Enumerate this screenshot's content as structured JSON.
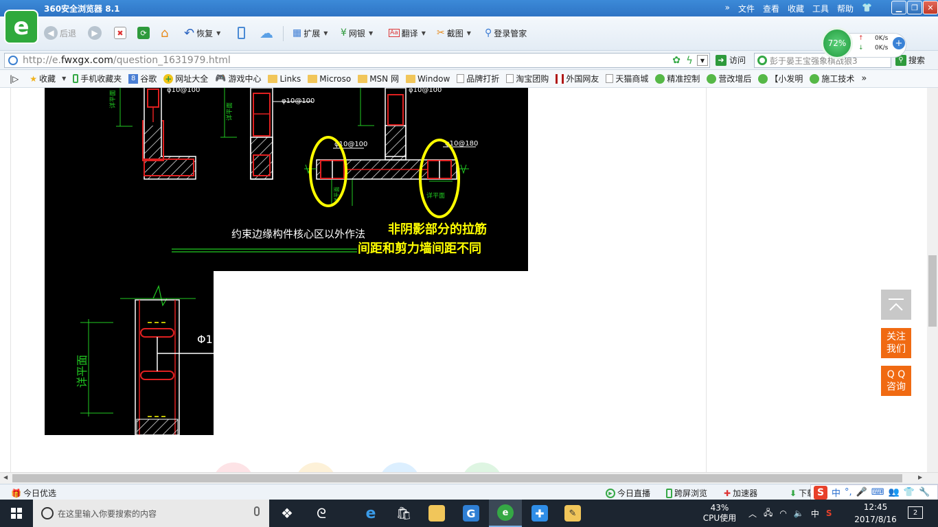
{
  "titlebar": {
    "title": "360安全浏览器 8.1",
    "menu": [
      "文件",
      "查看",
      "收藏",
      "工具",
      "帮助"
    ]
  },
  "toolbar": {
    "back": "后退",
    "restore": "恢复",
    "extend": "扩展",
    "bank": "网银",
    "translate": "翻译",
    "screenshot": "截图",
    "login": "登录管家"
  },
  "speed": {
    "percent": "72%",
    "up": "0K/s",
    "down": "0K/s"
  },
  "address": {
    "url_prefix": "http://e.",
    "url_domain": "fwxgx.com",
    "url_path": "/question_1631979.html",
    "visit": "访问",
    "search_text": "彭于晏王宝强象棋战狼3",
    "search_button": "搜索"
  },
  "bookmarks": [
    {
      "label": "收藏",
      "icon": "star"
    },
    {
      "label": "手机收藏夹",
      "icon": "phone"
    },
    {
      "label": "谷歌",
      "icon": "g"
    },
    {
      "label": "网址大全",
      "icon": "plus"
    },
    {
      "label": "游戏中心",
      "icon": "gamepad"
    },
    {
      "label": "Links",
      "icon": "folder"
    },
    {
      "label": "Microso",
      "icon": "folder"
    },
    {
      "label": "MSN 网",
      "icon": "folder"
    },
    {
      "label": "Window",
      "icon": "folder"
    },
    {
      "label": "品牌打折",
      "icon": "page"
    },
    {
      "label": "淘宝团购",
      "icon": "page"
    },
    {
      "label": "外国网友",
      "icon": "flag"
    },
    {
      "label": "天猫商城",
      "icon": "page"
    },
    {
      "label": "精准控制",
      "icon": "chat"
    },
    {
      "label": "营改增后",
      "icon": "chat"
    },
    {
      "label": "【小发明",
      "icon": "chat"
    },
    {
      "label": "施工技术",
      "icon": "chat"
    }
  ],
  "cad": {
    "rebar_labels": [
      "φ10@100",
      "φ10@100",
      "φ10@100",
      "φ10@100",
      "φ10@100",
      "φ10@180"
    ],
    "dim_label": "详平面",
    "title_line": "约束边缘构件核心区以外作法",
    "annotation_line1": "非阴影部分的拉筋",
    "annotation_line2": "间距和剪力墙间距不同",
    "cut_label": "Φ1"
  },
  "float": {
    "follow": "关注\n我们",
    "qq": "Q Q\n咨询"
  },
  "statusbar": {
    "today_pick": "今日优选",
    "live": "今日直播",
    "cross_screen": "跨屏浏览",
    "accelerator": "加速器",
    "download": "下载"
  },
  "taskbar": {
    "search_placeholder": "在这里输入你要搜索的内容",
    "cpu_percent": "43%",
    "cpu_label": "CPU使用",
    "ime_lang": "中",
    "time": "12:45",
    "date": "2017/8/16",
    "notifications": "2"
  },
  "colors": {
    "title_blue": "#2e74c4",
    "cad_bg": "#000000",
    "cad_green": "#22cc22",
    "cad_red": "#e02020",
    "cad_yellow": "#ffff00",
    "float_orange": "#f06a12"
  }
}
